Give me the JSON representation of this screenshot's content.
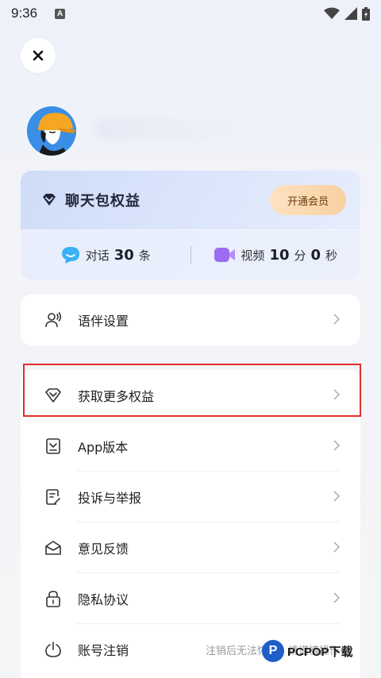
{
  "status_bar": {
    "time": "9:36",
    "notification_letter": "A"
  },
  "vip": {
    "title": "聊天包权益",
    "button": "开通会员",
    "chat": {
      "label": "对话",
      "count": "30",
      "unit": "条"
    },
    "video": {
      "label": "视频",
      "minutes": "10",
      "min_unit": "分",
      "seconds": "0",
      "sec_unit": "秒"
    }
  },
  "menu": {
    "voice_settings": "语伴设置",
    "get_more": "获取更多权益",
    "app_version": "App版本",
    "report": "投诉与举报",
    "feedback": "意见反馈",
    "privacy": "隐私协议",
    "cancel_account": "账号注销",
    "cancel_note": "注销后无法恢复，请谨慎操作"
  },
  "watermark": {
    "logo": "P",
    "text": "PCPOP下载"
  },
  "colors": {
    "accent_red": "#e0302a",
    "vip_button": "#f9cf9f",
    "video_icon": "#9b6cf2",
    "chat_icon": "#3ab0f5"
  }
}
